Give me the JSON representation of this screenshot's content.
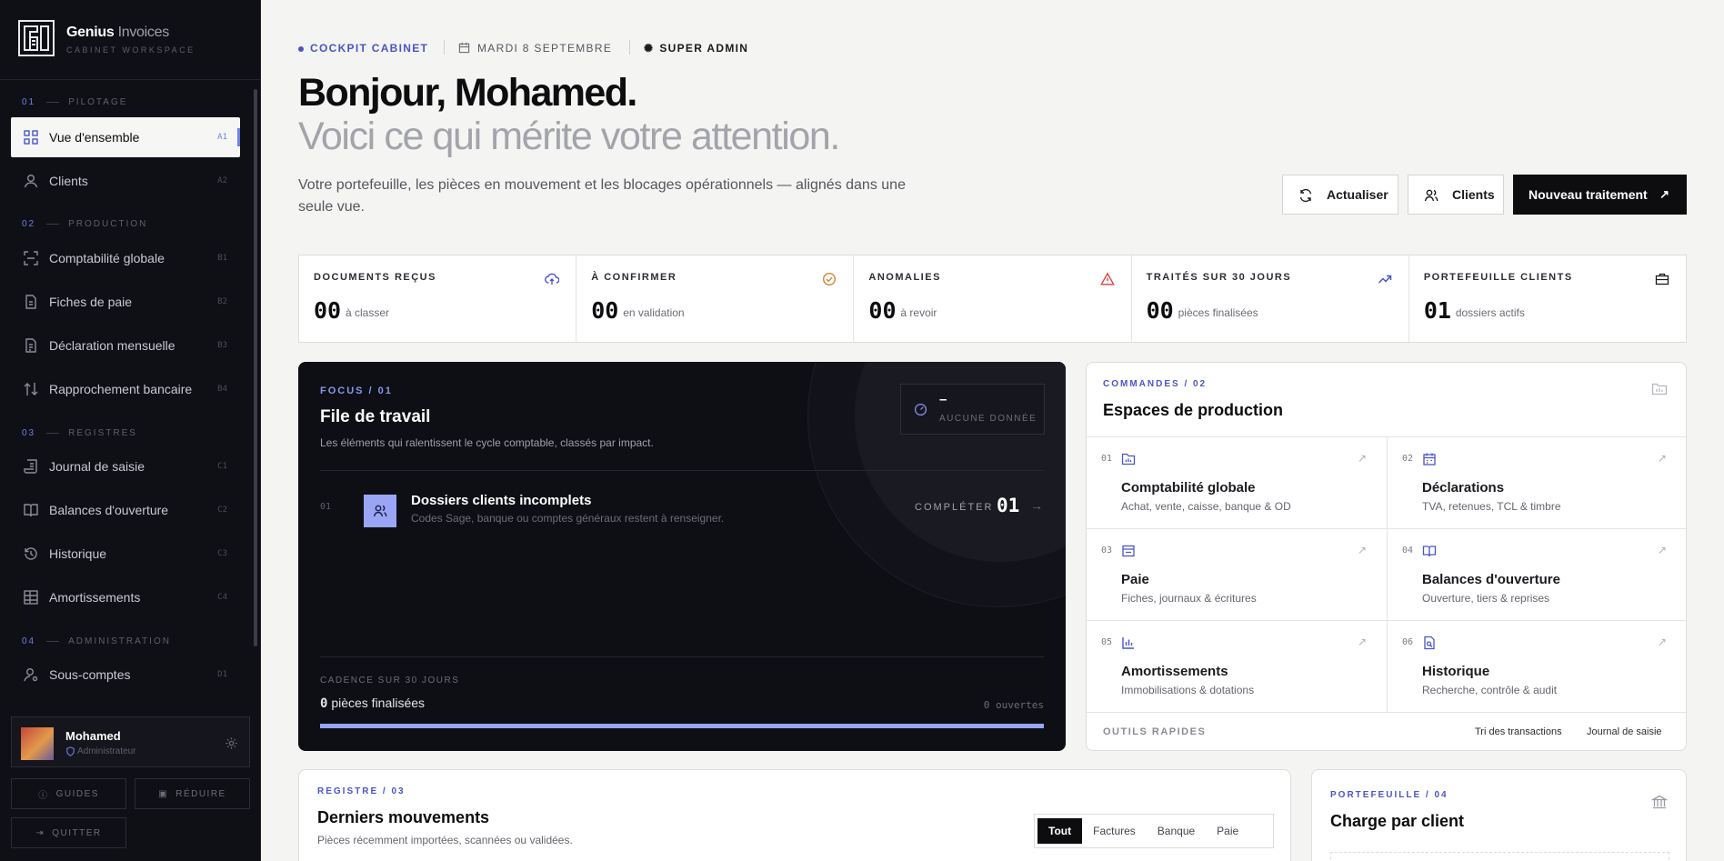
{
  "brand": {
    "name": "Genius",
    "name_light": "Invoices",
    "sub": "CABINET WORKSPACE"
  },
  "sections": [
    {
      "num": "01",
      "label": "PILOTAGE"
    },
    {
      "num": "02",
      "label": "PRODUCTION"
    },
    {
      "num": "03",
      "label": "REGISTRES"
    },
    {
      "num": "04",
      "label": "ADMINISTRATION"
    }
  ],
  "nav": [
    {
      "label": "Vue d'ensemble",
      "kbd": "A1",
      "icon": "grid-icon"
    },
    {
      "label": "Clients",
      "kbd": "A2",
      "icon": "user-icon"
    },
    {
      "label": "Comptabilité globale",
      "kbd": "B1",
      "icon": "scan-icon"
    },
    {
      "label": "Fiches de paie",
      "kbd": "B2",
      "icon": "document-icon"
    },
    {
      "label": "Déclaration mensuelle",
      "kbd": "B3",
      "icon": "document-icon"
    },
    {
      "label": "Rapprochement bancaire",
      "kbd": "B4",
      "icon": "arrows-icon"
    },
    {
      "label": "Journal de saisie",
      "kbd": "C1",
      "icon": "scroll-icon"
    },
    {
      "label": "Balances d'ouverture",
      "kbd": "C2",
      "icon": "book-icon"
    },
    {
      "label": "Historique",
      "kbd": "C3",
      "icon": "history-icon"
    },
    {
      "label": "Amortissements",
      "kbd": "C4",
      "icon": "table-icon"
    },
    {
      "label": "Sous-comptes",
      "kbd": "D1",
      "icon": "user-cog-icon"
    }
  ],
  "user": {
    "name": "Mohamed",
    "role": "Administrateur"
  },
  "footer_buttons": {
    "guides": "GUIDES",
    "reduce": "RÉDUIRE",
    "quit": "QUITTER"
  },
  "header": {
    "workspace": "COCKPIT CABINET",
    "date": "MARDI 8 SEPTEMBRE",
    "role": "SUPER ADMIN",
    "greeting": "Bonjour, Mohamed.",
    "subtitle": "Voici ce qui mérite votre attention.",
    "intro": "Votre portefeuille, les pièces en mouvement et les blocages opérationnels — alignés dans une seule vue."
  },
  "actions": {
    "refresh": "Actualiser",
    "clients": "Clients",
    "new": "Nouveau traitement"
  },
  "stats": [
    {
      "title": "DOCUMENTS REÇUS",
      "value": "00",
      "sub": "à classer",
      "icon": "cloud-upload-icon",
      "color": "#4a55c7"
    },
    {
      "title": "À CONFIRMER",
      "value": "00",
      "sub": "en validation",
      "icon": "check-circle-icon",
      "color": "#d9822b"
    },
    {
      "title": "ANOMALIES",
      "value": "00",
      "sub": "à revoir",
      "icon": "warning-icon",
      "color": "#d64545"
    },
    {
      "title": "TRAITÉS SUR 30 JOURS",
      "value": "00",
      "sub": "pièces finalisées",
      "icon": "trend-icon",
      "color": "#4a55c7"
    },
    {
      "title": "PORTEFEUILLE CLIENTS",
      "value": "01",
      "sub": "dossiers actifs",
      "icon": "briefcase-icon",
      "color": "#1a1a1f"
    }
  ],
  "focus": {
    "tag": "FOCUS / 01",
    "title": "File de travail",
    "desc": "Les éléments qui ralentissent le cycle comptable, classés par impact.",
    "badge_value": "–",
    "badge_label": "AUCUNE DONNÉE",
    "item": {
      "num": "01",
      "title": "Dossiers clients incomplets",
      "sub": "Codes Sage, banque ou comptes généraux restent à renseigner.",
      "action": "COMPLÉTER",
      "count": "01"
    },
    "cadence_label": "CADENCE SUR 30 JOURS",
    "cadence_value": "0",
    "cadence_text": "pièces finalisées",
    "open": "0 ouvertes",
    "progress": 1.0
  },
  "commands": {
    "tag": "COMMANDES / 02",
    "title": "Espaces de production",
    "cells": [
      {
        "n": "01",
        "title": "Comptabilité globale",
        "sub": "Achat, vente, caisse, banque & OD",
        "icon": "folder-chart-icon"
      },
      {
        "n": "02",
        "title": "Déclarations",
        "sub": "TVA, retenues, TCL & timbre",
        "icon": "calendar-icon"
      },
      {
        "n": "03",
        "title": "Paie",
        "sub": "Fiches, journaux & écritures",
        "icon": "wallet-icon"
      },
      {
        "n": "04",
        "title": "Balances d'ouverture",
        "sub": "Ouverture, tiers & reprises",
        "icon": "book-open-icon"
      },
      {
        "n": "05",
        "title": "Amortissements",
        "sub": "Immobilisations & dotations",
        "icon": "bar-chart-icon"
      },
      {
        "n": "06",
        "title": "Historique",
        "sub": "Recherche, contrôle & audit",
        "icon": "file-search-icon"
      }
    ],
    "tools_label": "OUTILS RAPIDES",
    "tools": [
      "Tri des transactions",
      "Journal de saisie"
    ]
  },
  "register": {
    "tag": "REGISTRE / 03",
    "title": "Derniers mouvements",
    "desc": "Pièces récemment importées, scannées ou validées.",
    "filters": [
      "Tout",
      "Factures",
      "Banque",
      "Paie"
    ]
  },
  "portfolio": {
    "tag": "PORTEFEUILLE / 04",
    "title": "Charge par client"
  }
}
